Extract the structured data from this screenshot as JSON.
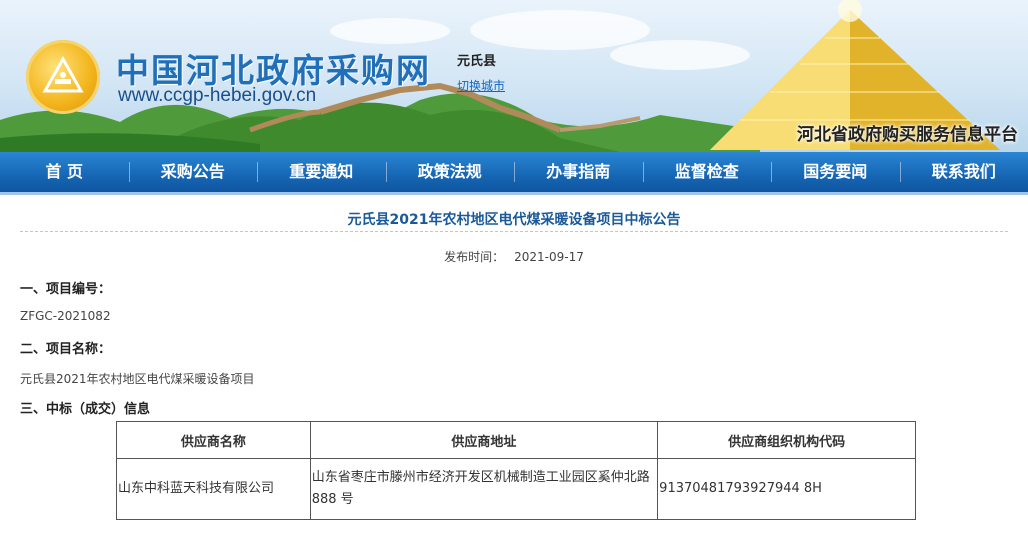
{
  "header": {
    "site_name": "中国河北政府采购网",
    "site_url": "www.ccgp-hebei.gov.cn",
    "city": "元氏县",
    "switch_city": "切换城市",
    "platform": "河北省政府购买服务信息平台"
  },
  "nav": {
    "items": [
      "首 页",
      "采购公告",
      "重要通知",
      "政策法规",
      "办事指南",
      "监督检查",
      "国务要闻",
      "联系我们"
    ]
  },
  "notice": {
    "title": "元氏县2021年农村地区电代煤采暖设备项目中标公告",
    "publish_label": "发布时间：",
    "publish_date": "2021-09-17",
    "sections": {
      "project_no_heading": "一、项目编号：",
      "project_no": "ZFGC-2021082",
      "project_name_heading": "二、项目名称：",
      "project_name": "元氏县2021年农村地区电代煤采暖设备项目",
      "winner_heading": "三、中标（成交）信息"
    },
    "table": {
      "headers": [
        "供应商名称",
        "供应商地址",
        "供应商组织机构代码"
      ],
      "rows": [
        [
          "山东中科蓝天科技有限公司",
          "山东省枣庄市滕州市经济开发区机械制造工业园区奚仲北路 888 号",
          "91370481793927944 8H"
        ]
      ]
    }
  },
  "colors": {
    "brand_blue": "#1f6fb9",
    "nav_blue": "#1666b4",
    "title_blue": "#1a5a9a",
    "logo_gold": "#f3b51d"
  },
  "icons": {
    "logo": "government-procurement-emblem"
  }
}
